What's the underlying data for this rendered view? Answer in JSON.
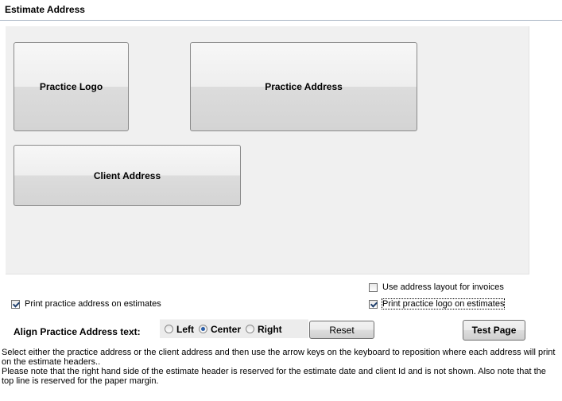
{
  "title": "Estimate Address",
  "layout_boxes": {
    "practice_logo": "Practice Logo",
    "practice_address": "Practice Address",
    "client_address": "Client Address"
  },
  "options": {
    "use_layout_for_invoices": {
      "label": "Use address layout for invoices",
      "checked": false
    },
    "print_practice_address": {
      "label": "Print practice address on estimates",
      "checked": true
    },
    "print_practice_logo": {
      "label": "Print practice logo on estimates",
      "checked": true
    }
  },
  "alignment": {
    "label": "Align Practice Address text:",
    "options": [
      "Left",
      "Center",
      "Right"
    ],
    "selected": "Center"
  },
  "buttons": {
    "reset": "Reset",
    "test_page": "Test Page"
  },
  "instructions": {
    "line1": "Select either the practice address or the client address and then use the arrow keys on the keyboard to reposition where each address will print on the estimate headers..",
    "line2": "Please note that the right hand side of the estimate header is reserved for the estimate date and client Id and is not shown. Also note that the top line is reserved for the paper margin."
  },
  "colors": {
    "panel_background": "#f0f0f0",
    "title_divider": "#a9b5c4",
    "radio_selected": "#2a5ea8"
  }
}
